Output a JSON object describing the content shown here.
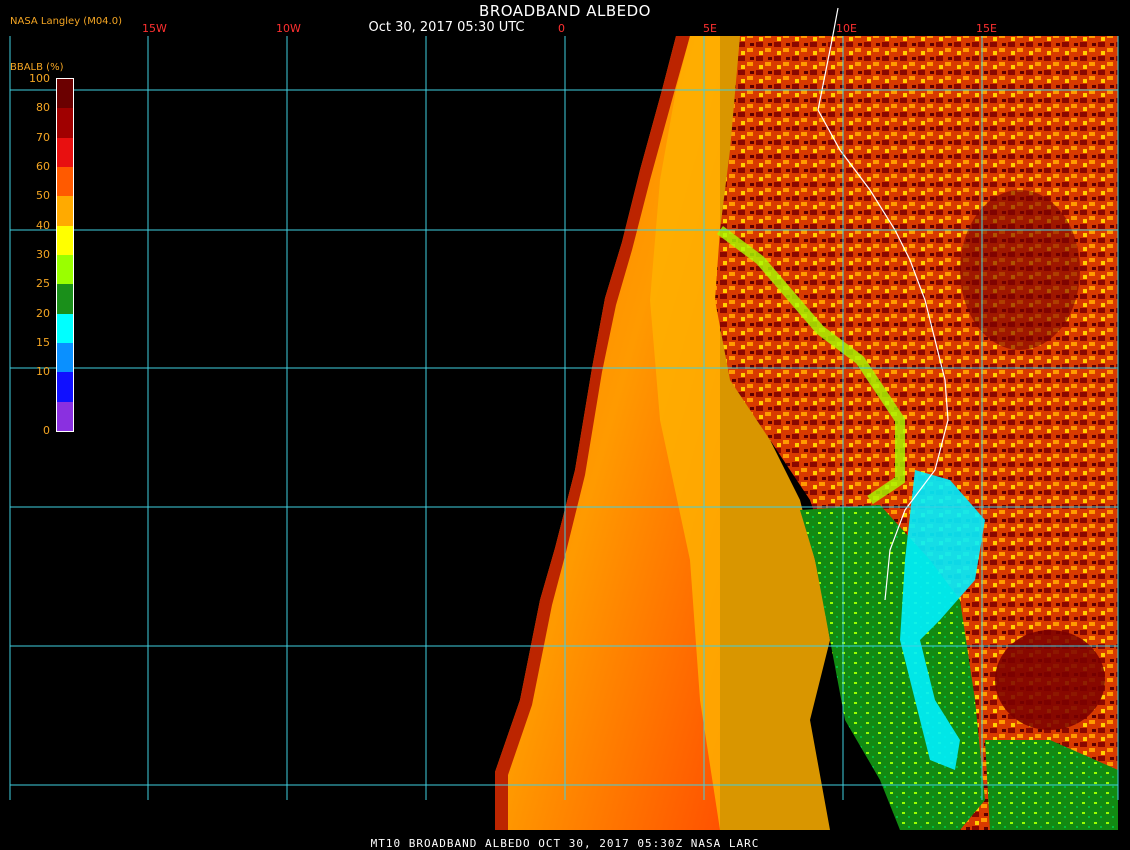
{
  "header": {
    "title": "BROADBAND ALBEDO",
    "subtitle": "Oct 30, 2017 05:30 UTC",
    "credit": "NASA Langley (M04.0)"
  },
  "legend": {
    "title": "BBALB (%)",
    "ticks": [
      "100",
      "80",
      "70",
      "60",
      "50",
      "40",
      "30",
      "25",
      "20",
      "15",
      "10",
      "0"
    ],
    "colors": [
      "#6b0000",
      "#a00000",
      "#e81010",
      "#ff5a00",
      "#ffaa00",
      "#ffff00",
      "#9aff00",
      "#1a8f1a",
      "#00ffff",
      "#0a90ff",
      "#1010ff",
      "#8a30e0"
    ]
  },
  "longitude_labels": [
    "15W",
    "10W",
    "0",
    "5E",
    "10E",
    "15E"
  ],
  "footer": "MT10  BROADBAND ALBEDO  OCT 30, 2017 05:30Z  NASA LARC"
}
